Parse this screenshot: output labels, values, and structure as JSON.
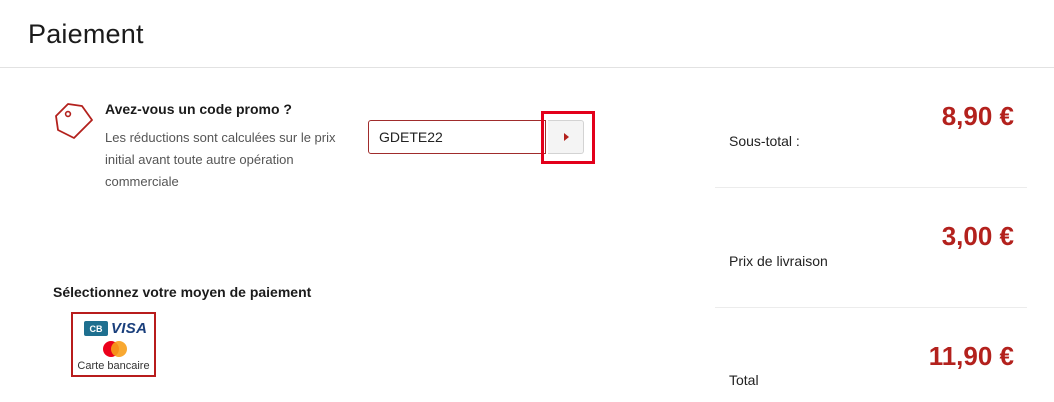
{
  "header": {
    "title": "Paiement"
  },
  "promo": {
    "title": "Avez-vous un code promo ?",
    "description": "Les réductions sont calculées sur le prix initial avant toute autre opération commerciale",
    "input_value": "GDETE22",
    "submit_icon": "caret-right-icon",
    "icon": "tag-icon"
  },
  "payment": {
    "title": "Sélectionnez votre moyen de paiement",
    "methods": [
      {
        "brand_cb": "CB",
        "brand_visa": "VISA",
        "label": "Carte bancaire"
      }
    ]
  },
  "summary": {
    "subtotal": {
      "label": "Sous-total :",
      "amount": "8,90 €"
    },
    "shipping": {
      "label": "Prix de livraison",
      "amount": "3,00 €"
    },
    "total": {
      "label": "Total",
      "amount": "11,90 €"
    }
  },
  "colors": {
    "accent": "#b3211d",
    "highlight": "#e3001b",
    "cb_blue": "#1e6f8f",
    "visa_blue": "#1a3f7c"
  }
}
